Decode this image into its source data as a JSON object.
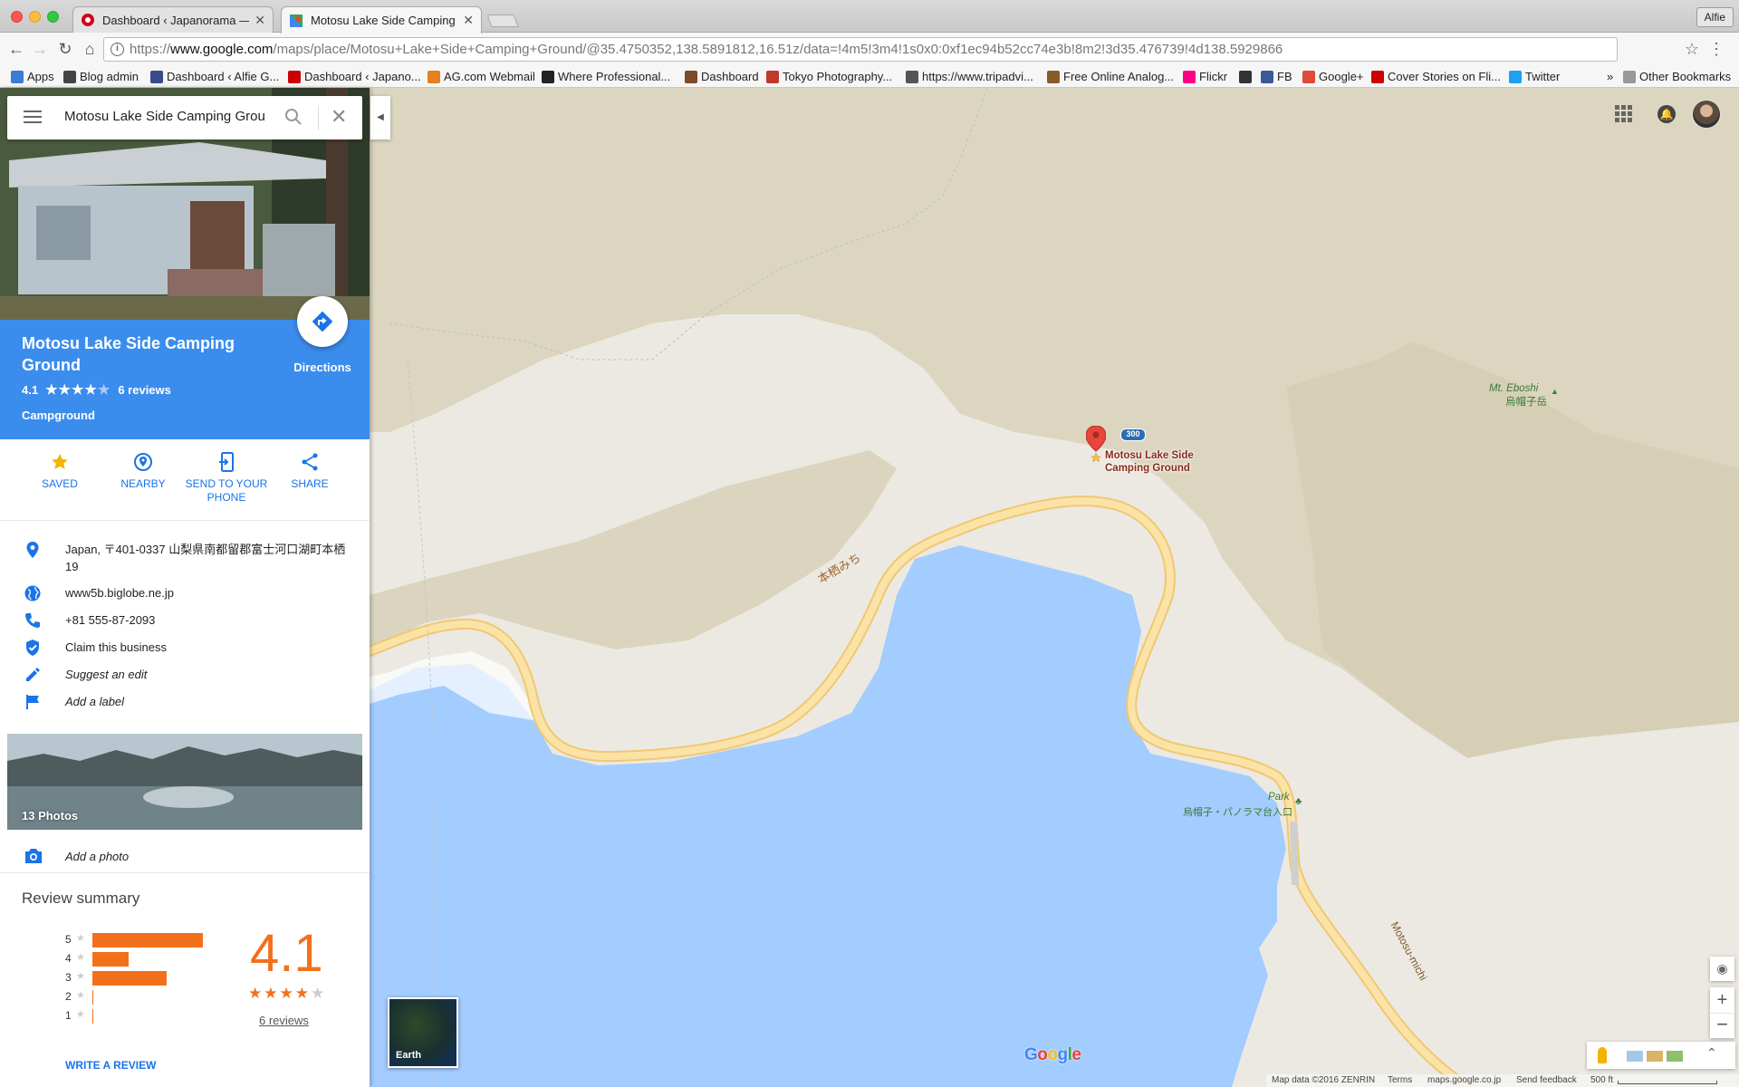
{
  "browser": {
    "tabs": [
      {
        "title": "Dashboard ‹ Japanorama — W",
        "active": false
      },
      {
        "title": "Motosu Lake Side Camping Gro",
        "active": true
      }
    ],
    "profile": "Alfie",
    "url_prefix": "https://",
    "url_host": "www.google.com",
    "url_path": "/maps/place/Motosu+Lake+Side+Camping+Ground/@35.4750352,138.5891812,16.51z/data=!4m5!3m4!1s0x0:0xf1ec94b52cc74e3b!8m2!3d35.476739!4d138.5929866",
    "bookmarks": [
      "Apps",
      "Blog admin",
      "Dashboard ‹ Alfie G...",
      "Dashboard ‹ Japano...",
      "AG.com Webmail",
      "Where Professional...",
      "Dashboard",
      "Tokyo Photography...",
      "https://www.tripadvi...",
      "Free Online Analog...",
      "Flickr",
      "",
      "FB",
      "Google+",
      "Cover Stories on Fli...",
      "Twitter"
    ],
    "bookmarks_overflow": "»",
    "other_bookmarks": "Other Bookmarks"
  },
  "search": {
    "value": "Motosu Lake Side Camping Grou"
  },
  "place": {
    "name": "Motosu Lake Side Camping Ground",
    "rating": "4.1",
    "rating_value": 4.1,
    "reviews": "6 reviews",
    "category": "Campground",
    "directions_label": "Directions"
  },
  "actions": [
    {
      "label": "SAVED",
      "icon": "star-icon"
    },
    {
      "label": "NEARBY",
      "icon": "nearby-icon"
    },
    {
      "label": "SEND TO YOUR PHONE",
      "icon": "send-to-phone-icon"
    },
    {
      "label": "SHARE",
      "icon": "share-icon"
    }
  ],
  "info": {
    "address": "Japan, 〒401-0337 山梨県南都留郡富士河口湖町本栖19",
    "website": "www5b.biglobe.ne.jp",
    "phone": "+81 555-87-2093",
    "claim": "Claim this business",
    "suggest_edit": "Suggest an edit",
    "add_label": "Add a label"
  },
  "photos": {
    "label": "13 Photos"
  },
  "add_photo": "Add a photo",
  "review_summary": {
    "title": "Review summary",
    "histogram": [
      {
        "stars": "5",
        "fraction": 1.0
      },
      {
        "stars": "4",
        "fraction": 0.33
      },
      {
        "stars": "3",
        "fraction": 0.67
      },
      {
        "stars": "2",
        "fraction": 0.0
      },
      {
        "stars": "1",
        "fraction": 0.0
      }
    ],
    "rating": "4.1",
    "reviews": "6 reviews",
    "write_review": "WRITE A REVIEW"
  },
  "map": {
    "pin_label_line1": "Motosu Lake Side",
    "pin_label_line2": "Camping Ground",
    "route_number": "300",
    "road_label_jp": "本栖みち",
    "road_label_en": "Motosu-michi",
    "mountain_name": "Mt. Eboshi",
    "mountain_name_jp": "烏帽子岳",
    "park_label": "Park",
    "park_label_jp": "烏帽子・パノラマ台入口",
    "earth_label": "Earth",
    "google_logo": "Google",
    "footer": {
      "data": "Map data ©2016 ZENRIN",
      "terms": "Terms",
      "domain": "maps.google.co.jp",
      "feedback": "Send feedback",
      "scale": "500 ft"
    },
    "colors": {
      "water": "#a3ccff",
      "land": "#ece9e2",
      "forest": "#d9d3bd",
      "road": "#f8dfa0"
    }
  }
}
